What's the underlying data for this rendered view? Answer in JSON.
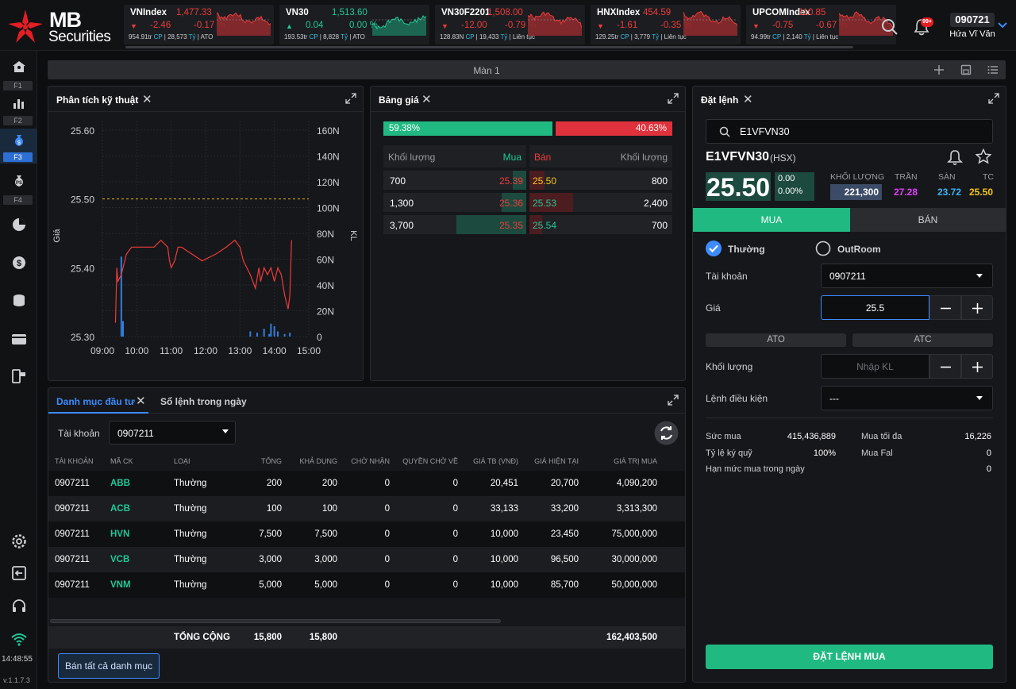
{
  "app": {
    "logo_line1": "MB",
    "logo_line2": "Securities",
    "version": "v.1.1.7.3",
    "clock": "14:48:55"
  },
  "indices": [
    {
      "name": "VNIndex",
      "points": "1,477.33",
      "arrow": "▼",
      "change": "-2.46",
      "pct": "-0.17 %",
      "vol": "954.91tr",
      "vol_unit": "CP",
      "value": "28,573",
      "value_unit": "Tỷ",
      "status": "ATO",
      "dir": "down"
    },
    {
      "name": "VN30",
      "points": "1,513.60",
      "arrow": "▲",
      "change": "0.04",
      "pct": "0.00 %",
      "vol": "193.53tr",
      "vol_unit": "CP",
      "value": "8,828",
      "value_unit": "Tỷ",
      "status": "ATO",
      "dir": "up"
    },
    {
      "name": "VN30F2201",
      "points": "1,508.00",
      "arrow": "▼",
      "change": "-12.00",
      "pct": "-0.79 %",
      "vol": "128.83N",
      "vol_unit": "CP",
      "value": "19,433",
      "value_unit": "Tỷ",
      "status": "Liên tục",
      "dir": "down"
    },
    {
      "name": "HNXIndex",
      "points": "454.59",
      "arrow": "▼",
      "change": "-1.61",
      "pct": "-0.35 %",
      "vol": "129.25tr",
      "vol_unit": "CP",
      "value": "3,779",
      "value_unit": "Tỷ",
      "status": "Liên tục",
      "dir": "down"
    },
    {
      "name": "UPCOMIndex",
      "points": "110.85",
      "arrow": "▼",
      "change": "-0.75",
      "pct": "-0.67 %",
      "vol": "94.99tr",
      "vol_unit": "CP",
      "value": "2,140",
      "value_unit": "Tỷ",
      "status": "Liên tục",
      "dir": "down"
    }
  ],
  "user": {
    "account": "090721",
    "name": "Hứa Vĩ Văn",
    "notif_badge": "99+"
  },
  "sidebar": [
    "F1",
    "F2",
    "F3",
    "F4"
  ],
  "screen": {
    "title": "Màn 1"
  },
  "technical": {
    "title": "Phân tích kỹ thuật"
  },
  "chart_data": {
    "type": "line",
    "title": "",
    "xlabel": "",
    "ylabel": "Giá",
    "y2label": "KL",
    "x_ticks": [
      "09:00",
      "10:00",
      "11:00",
      "12:00",
      "13:00",
      "14:00",
      "15:00"
    ],
    "y_ticks": [
      "25.60",
      "25.50",
      "25.40",
      "25.30"
    ],
    "y2_ticks": [
      "160N",
      "140N",
      "120N",
      "100N",
      "80N",
      "60N",
      "40N",
      "20N",
      "0"
    ],
    "ylim": [
      25.3,
      25.6
    ],
    "y2lim": [
      0,
      160
    ],
    "reference_price": 25.5,
    "series": [
      {
        "values": [
          [
            9.38,
            25.32
          ],
          [
            9.42,
            25.4
          ],
          [
            9.45,
            25.38
          ],
          [
            9.55,
            25.39
          ],
          [
            9.7,
            25.42
          ],
          [
            9.85,
            25.43
          ],
          [
            10.0,
            25.43
          ],
          [
            10.3,
            25.43
          ],
          [
            10.5,
            25.43
          ],
          [
            10.7,
            25.44
          ],
          [
            10.9,
            25.43
          ],
          [
            10.95,
            25.41
          ],
          [
            11.0,
            25.4
          ],
          [
            11.1,
            25.41
          ],
          [
            11.2,
            25.43
          ],
          [
            11.3,
            25.43
          ],
          [
            11.6,
            25.42
          ],
          [
            11.9,
            25.41
          ],
          [
            12.3,
            25.42
          ],
          [
            12.6,
            25.43
          ],
          [
            12.85,
            25.44
          ],
          [
            13.0,
            25.43
          ],
          [
            13.1,
            25.41
          ],
          [
            13.2,
            25.4
          ],
          [
            13.3,
            25.39
          ],
          [
            13.45,
            25.37
          ],
          [
            13.55,
            25.4
          ],
          [
            13.6,
            25.38
          ],
          [
            13.7,
            25.4
          ],
          [
            13.8,
            25.39
          ],
          [
            13.9,
            25.4
          ],
          [
            14.0,
            25.38
          ],
          [
            14.1,
            25.4
          ],
          [
            14.2,
            25.39
          ],
          [
            14.3,
            25.36
          ],
          [
            14.4,
            25.34
          ],
          [
            14.45,
            25.36
          ],
          [
            14.5,
            25.44
          ]
        ]
      }
    ],
    "volume": [
      [
        9.55,
        62
      ],
      [
        9.6,
        12
      ],
      [
        13.3,
        4
      ],
      [
        13.5,
        3
      ],
      [
        13.7,
        6
      ],
      [
        13.85,
        2
      ],
      [
        13.9,
        10
      ],
      [
        14.0,
        8
      ],
      [
        14.1,
        4
      ],
      [
        14.3,
        2
      ],
      [
        14.45,
        3
      ]
    ]
  },
  "pricebook": {
    "title": "Bảng giá",
    "buy_ratio": "59.38%",
    "sell_ratio": "40.63%",
    "buy_fraction": 0.5938,
    "headers": {
      "buy_vol": "Khối lượng",
      "buy_price": "Mua",
      "sell_price": "Bán",
      "sell_vol": "Khối lượng"
    },
    "rows": [
      {
        "buy_vol": "700",
        "buy_price": "25.39",
        "sell_price": "25.50",
        "sell_vol": "800",
        "buy_bar": 0.19,
        "sell_bar": 0.22
      },
      {
        "buy_vol": "1,300",
        "buy_price": "25.36",
        "sell_price": "25.53",
        "sell_vol": "2,400",
        "buy_bar": 0.35,
        "sell_bar": 0.65
      },
      {
        "buy_vol": "3,700",
        "buy_price": "25.35",
        "sell_price": "25.54",
        "sell_vol": "700",
        "buy_bar": 1.0,
        "sell_bar": 0.19
      }
    ]
  },
  "portfolio": {
    "tab_active": "Danh mục đầu tư",
    "tab_other": "Sổ lệnh trong ngày",
    "account_label": "Tài khoản",
    "account_value": "0907211",
    "columns": [
      "TÀI KHOẢN",
      "MÃ CK",
      "LOẠI",
      "TỔNG",
      "KHẢ DỤNG",
      "CHỜ NHẬN",
      "QUYỀN CHỜ VỀ",
      "GIÁ TB (VNĐ)",
      "GIÁ HIỆN TẠI",
      "GIÁ TRỊ MUA"
    ],
    "rows": [
      [
        "0907211",
        "ABB",
        "Thường",
        "200",
        "200",
        "0",
        "0",
        "20,451",
        "20,700",
        "4,090,200"
      ],
      [
        "0907211",
        "ACB",
        "Thường",
        "100",
        "100",
        "0",
        "0",
        "33,133",
        "33,200",
        "3,313,300"
      ],
      [
        "0907211",
        "HVN",
        "Thường",
        "7,500",
        "7,500",
        "0",
        "0",
        "10,000",
        "23,450",
        "75,000,000"
      ],
      [
        "0907211",
        "VCB",
        "Thường",
        "3,000",
        "3,000",
        "0",
        "0",
        "10,000",
        "96,500",
        "30,000,000"
      ],
      [
        "0907211",
        "VNM",
        "Thường",
        "5,000",
        "5,000",
        "0",
        "0",
        "10,000",
        "85,700",
        "50,000,000"
      ]
    ],
    "total_label": "TỔNG CỘNG",
    "total_qty": "15,800",
    "total_avail": "15,800",
    "total_value": "162,403,500",
    "sell_all": "Bán tất cả danh mục"
  },
  "order": {
    "title": "Đặt lệnh",
    "search_value": "E1VFVN30",
    "symbol": "E1VFVN30",
    "exchange": "(HSX)",
    "price": "25.50",
    "chg": "0.00",
    "chg_pct": "0.00%",
    "vol_label": "KHỐI LƯỢNG",
    "vol_value": "221,300",
    "ceil_label": "TRẦN",
    "ceil": "27.28",
    "floor_label": "SÀN",
    "floor": "23.72",
    "ref_label": "TC",
    "ref": "25.50",
    "buy_tab": "MUA",
    "sell_tab": "BÁN",
    "type_normal": "Thường",
    "type_outroom": "OutRoom",
    "account_label": "Tài khoản",
    "account_value": "0907211",
    "price_label": "Giá",
    "price_value": "25.5",
    "ato": "ATO",
    "atc": "ATC",
    "qty_label": "Khối lượng",
    "qty_placeholder": "Nhập KL",
    "cond_label": "Lệnh điều kiện",
    "cond_value": "---",
    "power_label": "Sức mua",
    "power": "415,436,889",
    "maxbuy_label": "Mua tối đa",
    "maxbuy": "16,226",
    "margin_label": "Tỷ lệ ký quỹ",
    "margin": "100%",
    "fal_label": "Mua Fal",
    "fal": "0",
    "limit_label": "Hạn mức mua trong ngày",
    "limit": "0",
    "submit": "ĐẶT LỆNH MUA"
  }
}
